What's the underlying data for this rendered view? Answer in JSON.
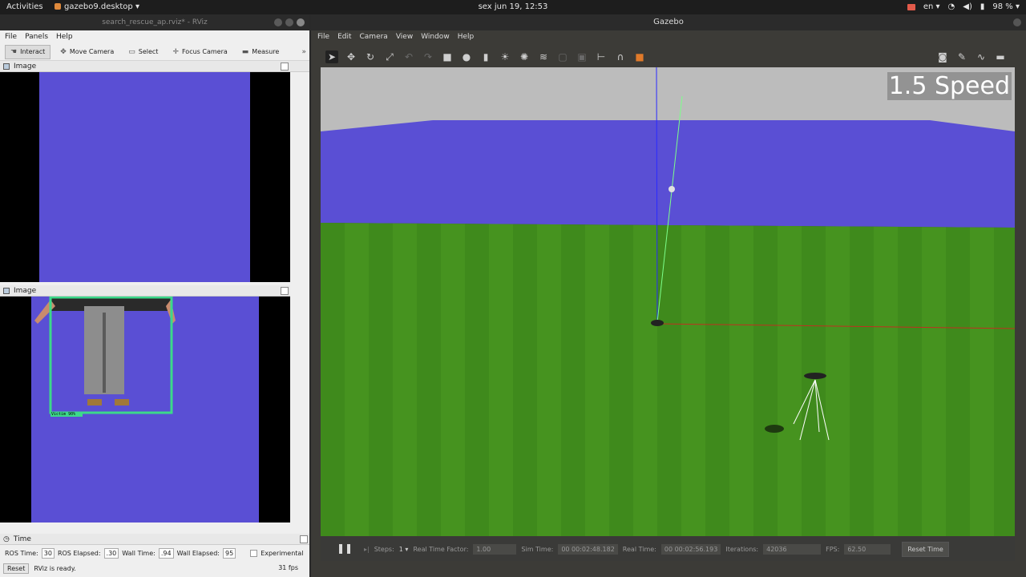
{
  "topbar": {
    "activities": "Activities",
    "app": "gazebo9.desktop ▾",
    "clock": "sex jun 19, 12:53",
    "lang": "en ▾",
    "battery": "98 % ▾"
  },
  "rviz": {
    "title": "search_rescue_ap.rviz* - RViz",
    "menu": [
      "File",
      "Panels",
      "Help"
    ],
    "tools": [
      "Interact",
      "Move Camera",
      "Select",
      "Focus Camera",
      "Measure"
    ],
    "tool_icons": [
      "hand-icon",
      "move-icon",
      "select-icon",
      "focus-icon",
      "ruler-icon"
    ],
    "panel1": "Image",
    "panel2": "Image",
    "detection_label": "Victim 90%",
    "time_panel": "Time",
    "time": {
      "ros_time_label": "ROS Time:",
      "ros_time": "30",
      "ros_elapsed_label": "ROS Elapsed:",
      "ros_elapsed": ".30",
      "wall_time_label": "Wall Time:",
      "wall_time": ".94",
      "wall_elapsed_label": "Wall Elapsed:",
      "wall_elapsed": "95",
      "experimental": "Experimental"
    },
    "status": {
      "reset": "Reset",
      "message": "RViz is ready.",
      "fps": "31 fps"
    }
  },
  "gazebo": {
    "title": "Gazebo",
    "menu": [
      "File",
      "Edit",
      "Camera",
      "View",
      "Window",
      "Help"
    ],
    "speed_overlay": "1.5 Speed",
    "bottom": {
      "steps_label": "Steps:",
      "steps": "1 ▾",
      "rtf_label": "Real Time Factor:",
      "rtf": "1.00",
      "sim_label": "Sim Time:",
      "sim": "00 00:02:48.182",
      "real_label": "Real Time:",
      "real": "00 00:02:56.193",
      "iter_label": "Iterations:",
      "iter": "42036",
      "fps_label": "FPS:",
      "fps": "62.50",
      "reset": "Reset Time"
    }
  },
  "colors": {
    "sky": "#5a4fd4",
    "grass": "#3f8a1c",
    "bbox": "#3cd98a"
  }
}
